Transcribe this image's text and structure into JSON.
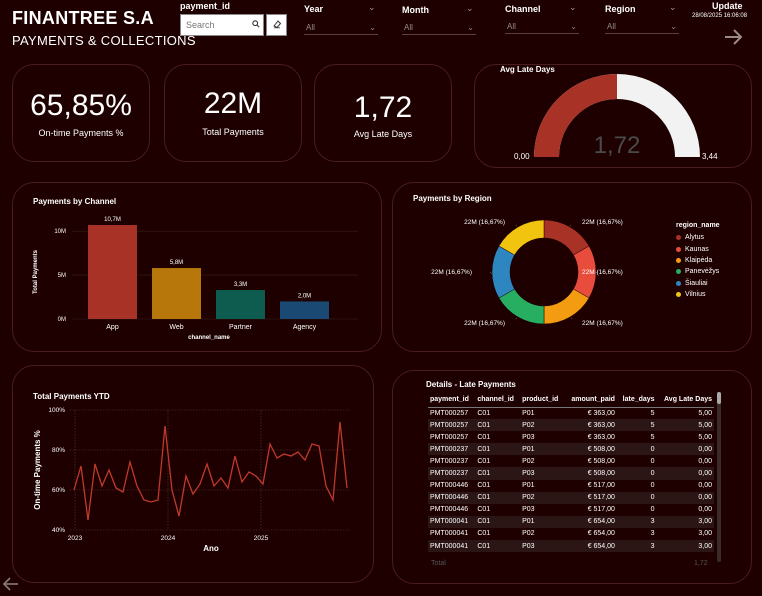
{
  "header": {
    "brand": "FINANTREE S.A",
    "subtitle": "PAYMENTS & COLLECTIONS"
  },
  "filters": {
    "payment_id": {
      "label": "payment_id",
      "placeholder": "Search"
    },
    "year": {
      "label": "Year",
      "value": "All"
    },
    "month": {
      "label": "Month",
      "value": "All"
    },
    "channel": {
      "label": "Channel",
      "value": "All"
    },
    "region": {
      "label": "Region",
      "value": "All"
    }
  },
  "update": {
    "label": "Update",
    "timestamp": "28/08/2025 16:06:08"
  },
  "kpis": {
    "ontime": {
      "value": "65,85%",
      "label": "On-time Payments %"
    },
    "total": {
      "value": "22M",
      "label": "Total Payments"
    },
    "late": {
      "value": "1,72",
      "label": "Avg Late Days"
    }
  },
  "gauge": {
    "title": "Avg Late Days",
    "min_label": "0,00",
    "max_label": "3,44",
    "value_label": "1,72",
    "value": 1.72,
    "min": 0,
    "max": 3.44,
    "fill_color": "#a93226",
    "track_color": "#f2f2f2"
  },
  "channel_chart": {
    "title": "Payments by Channel",
    "chart_data": {
      "type": "bar",
      "categories": [
        "App",
        "Web",
        "Partner",
        "Agency"
      ],
      "values": [
        10.7,
        5.8,
        3.3,
        2.0
      ],
      "data_labels": [
        "10,7M",
        "5,8M",
        "3,3M",
        "2,0M"
      ],
      "colors": [
        "#a93226",
        "#b8770b",
        "#0e5c4f",
        "#1a4a73"
      ],
      "xlabel": "channel_name",
      "ylabel": "Total Payments",
      "yticks": [
        0,
        5,
        10
      ],
      "ytick_labels": [
        "0M",
        "5M",
        "10M"
      ],
      "ylim": [
        0,
        11.5
      ]
    }
  },
  "region_chart": {
    "title": "Payments by Region",
    "chart_data": {
      "type": "pie",
      "categories": [
        "Alytus",
        "Kaunas",
        "Klaipėda",
        "Panevėžys",
        "Šiauliai",
        "Vilnius"
      ],
      "values": [
        16.67,
        16.67,
        16.67,
        16.67,
        16.67,
        16.67
      ],
      "colors": [
        "#a93226",
        "#e74c3c",
        "#f39c12",
        "#27ae60",
        "#2e86c1",
        "#f1c40f"
      ],
      "labels": [
        "22M (16,67%)",
        "22M (16,67%)",
        "22M (16,67%)",
        "22M (16,67%)",
        "22M (16,67%)",
        "22M (16,67%)"
      ],
      "legend_title": "region_name"
    }
  },
  "ytd_chart": {
    "title": "Total Payments YTD",
    "chart_data": {
      "type": "line",
      "xlabel": "Ano",
      "ylabel": "On-time Payments %",
      "xticks": [
        "2023",
        "2024",
        "2025"
      ],
      "ytick_labels": [
        "40%",
        "60%",
        "80%",
        "100%"
      ],
      "ylim": [
        40,
        100
      ],
      "color": "#c0392b",
      "values": [
        60,
        72,
        45,
        73,
        62,
        70,
        61,
        59,
        74,
        62,
        55,
        54,
        55,
        92,
        60,
        47,
        67,
        58,
        63,
        73,
        62,
        66,
        61,
        77,
        64,
        69,
        67,
        63,
        83,
        76,
        78,
        77,
        79,
        75,
        83,
        82,
        62,
        55,
        94,
        61
      ]
    }
  },
  "details": {
    "title": "Details - Late Payments",
    "columns": [
      "payment_id",
      "channel_id",
      "product_id",
      "amount_paid",
      "late_days",
      "Avg Late Days"
    ],
    "rows": [
      [
        "PMT000257",
        "C01",
        "P01",
        "€ 363,00",
        "5",
        "5,00"
      ],
      [
        "PMT000257",
        "C01",
        "P02",
        "€ 363,00",
        "5",
        "5,00"
      ],
      [
        "PMT000257",
        "C01",
        "P03",
        "€ 363,00",
        "5",
        "5,00"
      ],
      [
        "PMT000237",
        "C01",
        "P01",
        "€ 508,00",
        "0",
        "0,00"
      ],
      [
        "PMT000237",
        "C01",
        "P02",
        "€ 508,00",
        "0",
        "0,00"
      ],
      [
        "PMT000237",
        "C01",
        "P03",
        "€ 508,00",
        "0",
        "0,00"
      ],
      [
        "PMT000446",
        "C01",
        "P01",
        "€ 517,00",
        "0",
        "0,00"
      ],
      [
        "PMT000446",
        "C01",
        "P02",
        "€ 517,00",
        "0",
        "0,00"
      ],
      [
        "PMT000446",
        "C01",
        "P03",
        "€ 517,00",
        "0",
        "0,00"
      ],
      [
        "PMT000041",
        "C01",
        "P01",
        "€ 654,00",
        "3",
        "3,00"
      ],
      [
        "PMT000041",
        "C01",
        "P02",
        "€ 654,00",
        "3",
        "3,00"
      ],
      [
        "PMT000041",
        "C01",
        "P03",
        "€ 654,00",
        "3",
        "3,00"
      ]
    ],
    "total_label": "Total",
    "total_value": "1,72"
  }
}
